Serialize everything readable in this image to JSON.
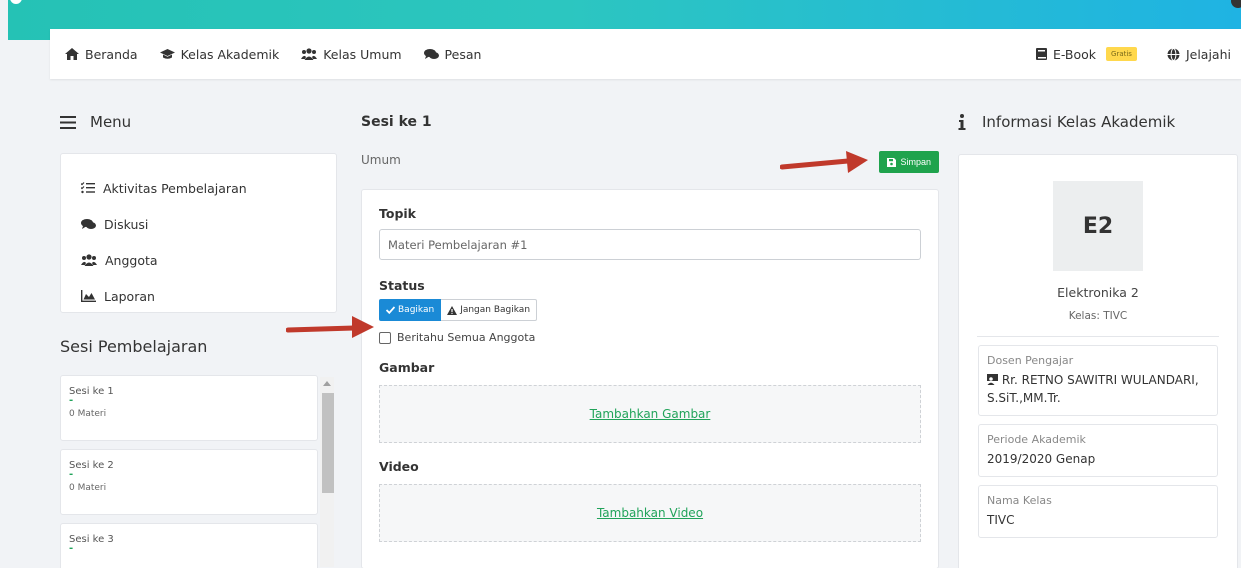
{
  "nav": {
    "items": [
      {
        "label": "Beranda",
        "icon": "home-icon"
      },
      {
        "label": "Kelas Akademik",
        "icon": "graduation-cap-icon"
      },
      {
        "label": "Kelas Umum",
        "icon": "users-icon"
      },
      {
        "label": "Pesan",
        "icon": "comments-icon"
      }
    ],
    "ebook_label": "E-Book",
    "ebook_badge": "Gratis",
    "explore_label": "Jelajahi"
  },
  "sidebar": {
    "menu_title": "Menu",
    "items": [
      {
        "label": "Aktivitas Pembelajaran",
        "icon": "tasks-icon"
      },
      {
        "label": "Diskusi",
        "icon": "comments-icon"
      },
      {
        "label": "Anggota",
        "icon": "users-icon"
      },
      {
        "label": "Laporan",
        "icon": "chart-area-icon"
      }
    ],
    "sessions_title": "Sesi Pembelajaran",
    "sessions": [
      {
        "title": "Sesi ke 1",
        "topic": "-",
        "count": "0 Materi"
      },
      {
        "title": "Sesi ke 2",
        "topic": "-",
        "count": "0 Materi"
      },
      {
        "title": "Sesi ke 3",
        "topic": "-",
        "count": ""
      }
    ]
  },
  "main": {
    "title": "Sesi ke 1",
    "section": "Umum",
    "save_label": "Simpan",
    "topic_label": "Topik",
    "topic_value": "Materi Pembelajaran #1",
    "status_label": "Status",
    "share_label": "Bagikan",
    "no_share_label": "Jangan Bagikan",
    "notify_label": "Beritahu Semua Anggota",
    "image_label": "Gambar",
    "add_image": "Tambahkan Gambar",
    "video_label": "Video",
    "add_video": "Tambahkan Video"
  },
  "info": {
    "title": "Informasi Kelas Akademik",
    "avatar_text": "E2",
    "class_name": "Elektronika 2",
    "class_sub": "Kelas: TIVC",
    "lecturer_label": "Dosen Pengajar",
    "lecturer_value": "Rr. RETNO SAWITRI WULANDARI, S.SiT.,MM.Tr.",
    "period_label": "Periode Akademik",
    "period_value": "2019/2020 Genap",
    "class_label": "Nama Kelas",
    "class_value": "TIVC"
  },
  "colors": {
    "accent_green": "#1fa34d",
    "accent_blue": "#1a8ad6",
    "arrow_red": "#c0392b",
    "header_gradient_start": "#25c2b5",
    "header_gradient_end": "#1fb3e3"
  }
}
